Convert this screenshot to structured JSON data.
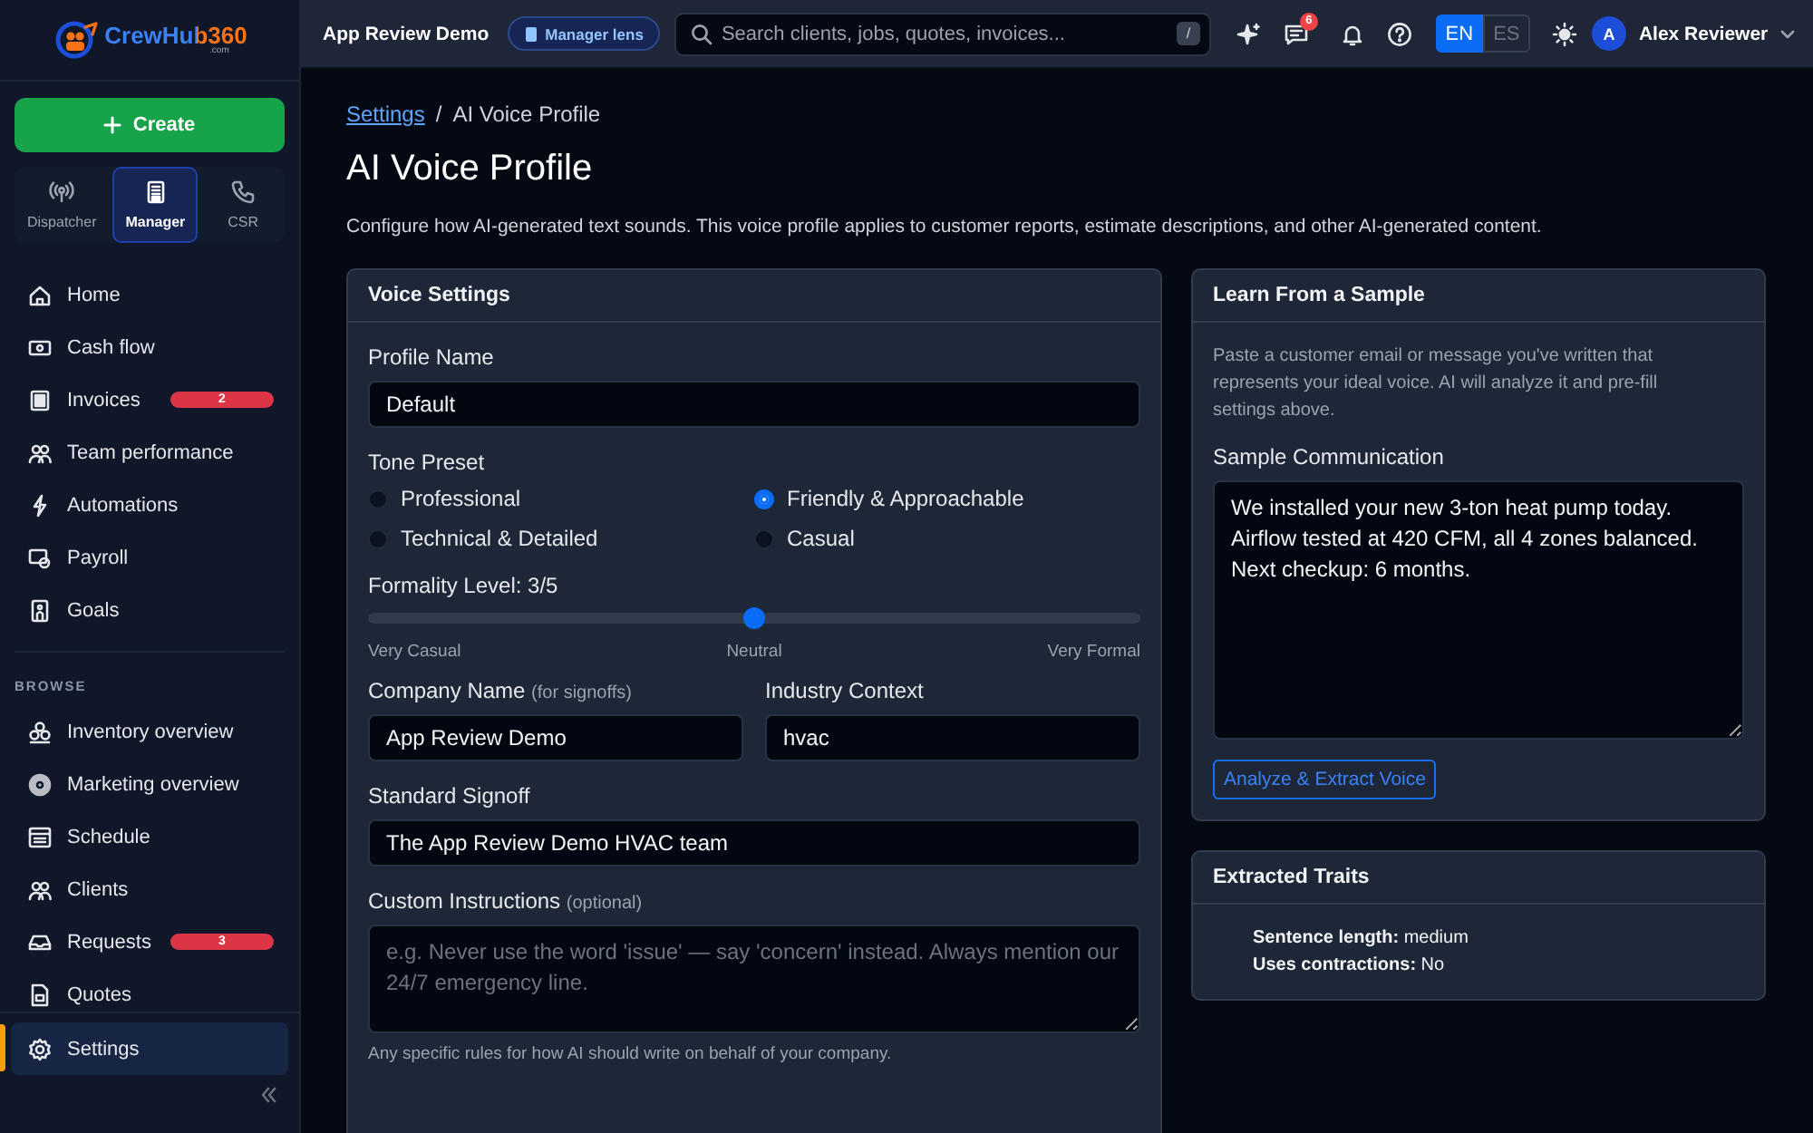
{
  "logo": {
    "name": "CrewHub360",
    "suffix": ".com"
  },
  "sidebar": {
    "create_label": "Create",
    "roles": [
      {
        "label": "Dispatcher",
        "selected": false
      },
      {
        "label": "Manager",
        "selected": true
      },
      {
        "label": "CSR",
        "selected": false
      }
    ],
    "items": [
      {
        "label": "Home",
        "selected": false
      },
      {
        "label": "Cash flow",
        "selected": false
      },
      {
        "label": "Invoices",
        "badge": "2",
        "selected": false
      },
      {
        "label": "Team performance",
        "selected": false
      },
      {
        "label": "Automations",
        "selected": false
      },
      {
        "label": "Payroll",
        "selected": false
      },
      {
        "label": "Goals",
        "selected": false
      }
    ],
    "section_label": "BROWSE",
    "browse_items": [
      {
        "label": "Inventory overview",
        "selected": false
      },
      {
        "label": "Marketing overview",
        "selected": false
      },
      {
        "label": "Schedule",
        "selected": false
      },
      {
        "label": "Clients",
        "selected": false
      },
      {
        "label": "Requests",
        "badge": "3",
        "selected": false
      },
      {
        "label": "Quotes",
        "selected": false
      }
    ],
    "footer_item": {
      "label": "Settings",
      "selected": true
    }
  },
  "topbar": {
    "org": "App Review Demo",
    "lens": "Manager lens",
    "search_placeholder": "Search clients, jobs, quotes, invoices...",
    "shortcut": "/",
    "messages_badge": "6",
    "languages": [
      {
        "label": "EN",
        "selected": true
      },
      {
        "label": "ES",
        "selected": false
      }
    ],
    "user": {
      "initial": "A",
      "name": "Alex Reviewer"
    }
  },
  "breadcrumb": {
    "link": "Settings",
    "separator": "/",
    "current": "AI Voice Profile"
  },
  "title": "AI Voice Profile",
  "description": "Configure how AI-generated text sounds. This voice profile applies to customer reports, estimate descriptions, and other AI-generated content.",
  "voice_settings": {
    "title": "Voice Settings",
    "profile_name": {
      "label": "Profile Name",
      "value": "Default"
    },
    "tone": {
      "label": "Tone Preset",
      "options": [
        {
          "label": "Professional",
          "selected": false
        },
        {
          "label": "Friendly & Approachable",
          "selected": true
        },
        {
          "label": "Technical & Detailed",
          "selected": false
        },
        {
          "label": "Casual",
          "selected": false
        }
      ]
    },
    "formality": {
      "label": "Formality Level: 3/5",
      "level": 0.5,
      "scale": [
        "Very Casual",
        "Neutral",
        "Very Formal"
      ]
    },
    "company_name": {
      "label": "Company Name",
      "hint": "(for signoffs)",
      "value": "App Review Demo"
    },
    "industry": {
      "label": "Industry Context",
      "value": "hvac"
    },
    "signoff": {
      "label": "Standard Signoff",
      "value": "The App Review Demo HVAC team"
    },
    "custom": {
      "label": "Custom Instructions",
      "hint": "(optional)",
      "placeholder": "e.g. Never use the word 'issue' — say 'concern' instead. Always mention our 24/7 emergency line.",
      "help": "Any specific rules for how AI should write on behalf of your company."
    }
  },
  "sample": {
    "title": "Learn From a Sample",
    "description": "Paste a customer email or message you've written that represents your ideal voice. AI will analyze it and pre-fill settings above.",
    "field_label": "Sample Communication",
    "value": "We installed your new 3-ton heat pump today.\nAirflow tested at 420 CFM, all 4 zones balanced.\nNext checkup: 6 months.",
    "button": "Analyze & Extract Voice"
  },
  "traits": {
    "title": "Extracted Traits",
    "items": [
      "**Sentence length:** medium",
      "**Uses contractions:** No"
    ]
  }
}
